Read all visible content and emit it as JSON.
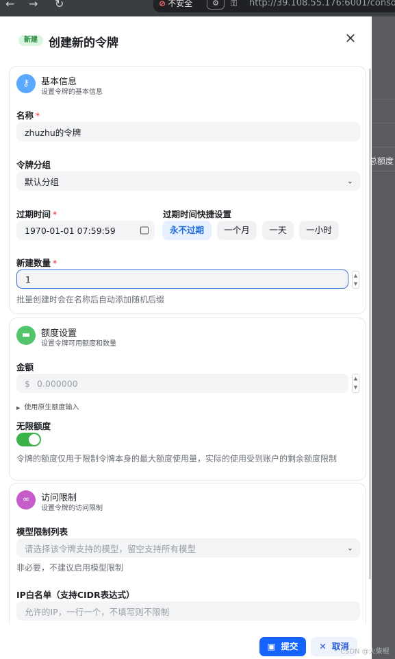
{
  "browser": {
    "insecure_label": "不安全",
    "url": "http://39.108.55.176:6001/conso"
  },
  "backdrop": {
    "peek_text": "总额度"
  },
  "modal": {
    "badge": "新建",
    "title": "创建新的令牌",
    "close_icon": "×"
  },
  "basic": {
    "title": "基本信息",
    "subtitle": "设置令牌的基本信息",
    "icon_color": "#5aa8ff",
    "name_label": "名称",
    "name_value": "zhuzhu的令牌",
    "group_label": "令牌分组",
    "group_value": "默认分组",
    "expire_label": "过期时间",
    "expire_value": "1970-01-01 07:59:59",
    "quick_label": "过期时间快捷设置",
    "quick_options": [
      "永不过期",
      "一个月",
      "一天",
      "一小时"
    ],
    "quick_selected": "永不过期",
    "count_label": "新建数量",
    "count_value": "1",
    "count_help": "批量创建时会在名称后自动添加随机后缀"
  },
  "quota": {
    "title": "额度设置",
    "subtitle": "设置令牌可用额度和数量",
    "icon_color": "#52c46b",
    "amount_label": "金额",
    "amount_prefix": "$",
    "amount_placeholder": "0.000000",
    "raw_input_label": "使用原生额度输入",
    "unlimited_label": "无限额度",
    "unlimited_on": true,
    "unlimited_help": "令牌的额度仅用于限制令牌本身的最大额度使用量，实际的使用受到账户的剩余额度限制"
  },
  "access": {
    "title": "访问限制",
    "subtitle": "设置令牌的访问限制",
    "icon_color": "#c65cc9",
    "models_label": "模型限制列表",
    "models_placeholder": "请选择该令牌支持的模型，留空支持所有模型",
    "models_help": "非必要，不建议启用模型限制",
    "ip_label": "IP白名单（支持CIDR表达式）",
    "ip_placeholder": "允许的IP，一行一个，不填写则不限制"
  },
  "footer": {
    "submit_label": "提交",
    "cancel_label": "取消",
    "watermark": "CSDN @火柴棍"
  }
}
